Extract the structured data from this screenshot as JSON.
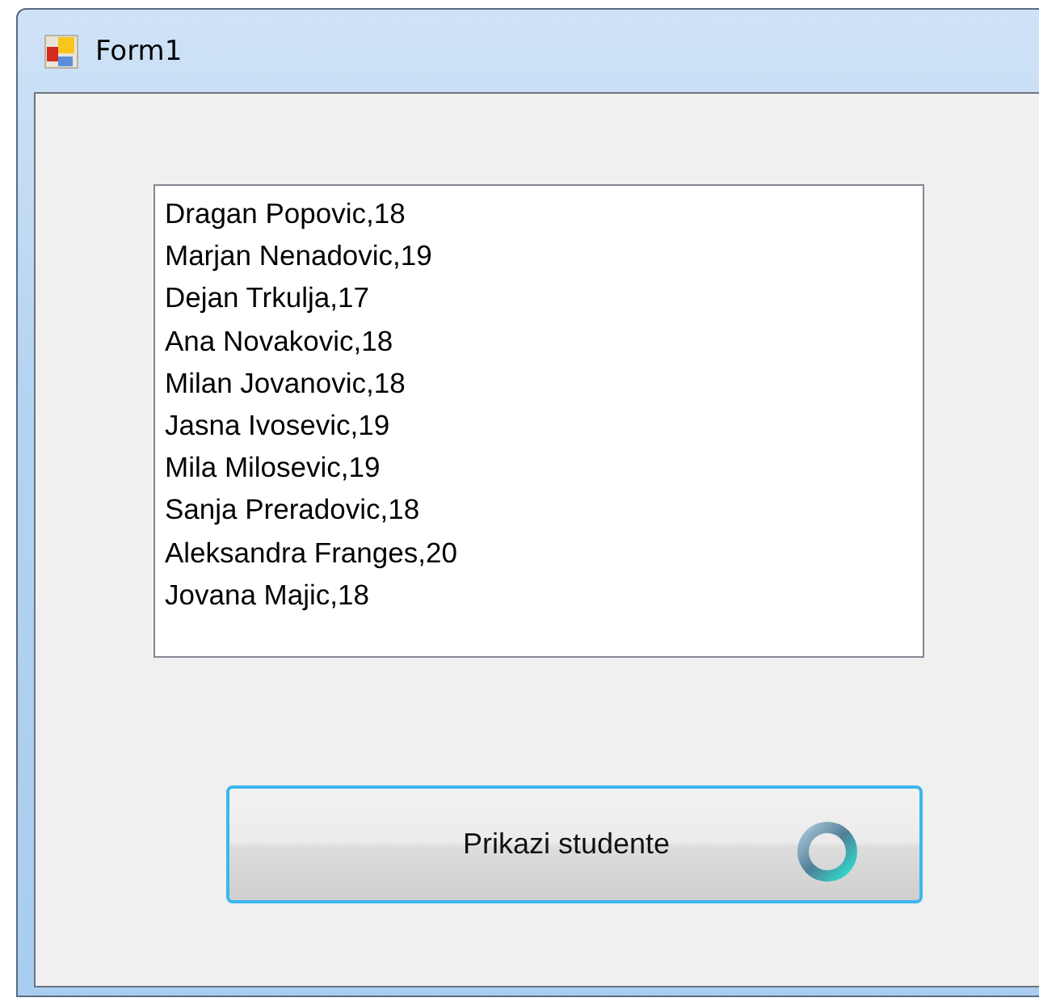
{
  "window": {
    "title": "Form1"
  },
  "listbox": {
    "items": [
      "Dragan Popovic,18",
      "Marjan Nenadovic,19",
      "Dejan Trkulja,17",
      "Ana Novakovic,18",
      "Milan Jovanovic,18",
      "Jasna Ivosevic,19",
      "Mila Milosevic,19",
      "Sanja Preradovic,18",
      "Aleksandra Franges,20",
      "Jovana Majic,18"
    ]
  },
  "button": {
    "label": "Prikazi studente",
    "focused": true
  }
}
